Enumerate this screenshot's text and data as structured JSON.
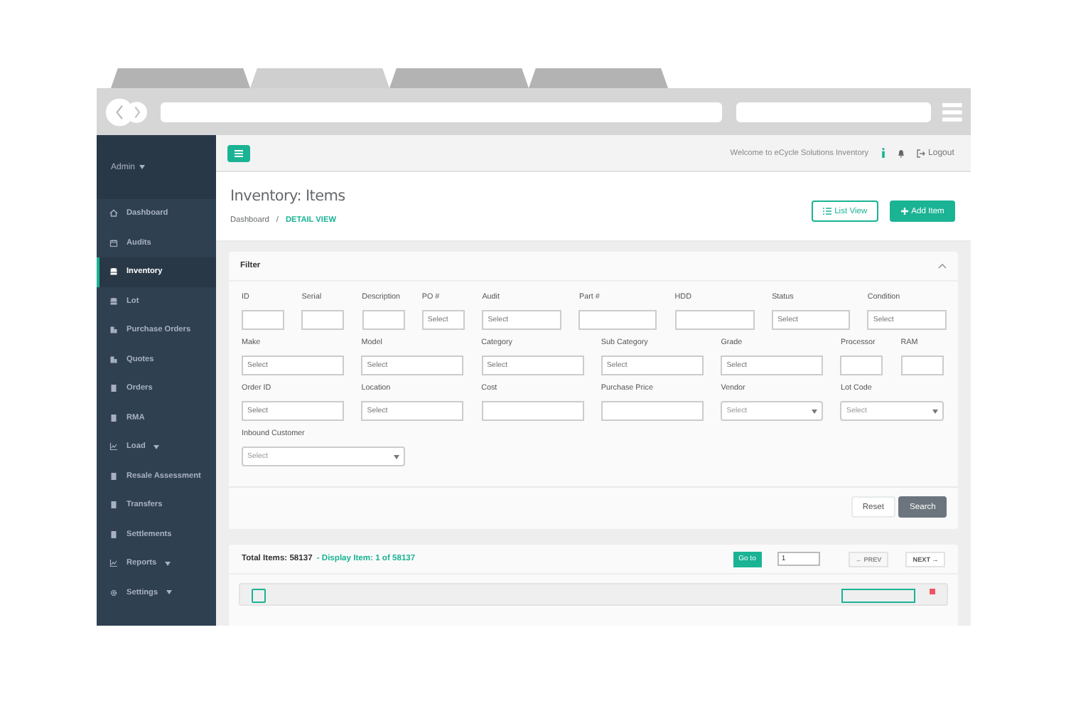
{
  "browser": {
    "tabs": [
      {
        "selected": false
      },
      {
        "selected": true
      },
      {
        "selected": false
      },
      {
        "selected": false
      }
    ]
  },
  "sidebar": {
    "user": "Admin",
    "items": [
      {
        "label": "Dashboard",
        "selected": false,
        "caret": false
      },
      {
        "label": "Audits",
        "selected": false,
        "caret": false
      },
      {
        "label": "Inventory",
        "selected": true,
        "caret": false
      },
      {
        "label": "Lot",
        "selected": false,
        "caret": false
      },
      {
        "label": "Purchase Orders",
        "selected": false,
        "caret": false
      },
      {
        "label": "Quotes",
        "selected": false,
        "caret": false
      },
      {
        "label": "Orders",
        "selected": false,
        "caret": false
      },
      {
        "label": "RMA",
        "selected": false,
        "caret": false
      },
      {
        "label": "Load",
        "selected": false,
        "caret": true
      },
      {
        "label": "Resale Assessment",
        "selected": false,
        "caret": false
      },
      {
        "label": "Transfers",
        "selected": false,
        "caret": false
      },
      {
        "label": "Settlements",
        "selected": false,
        "caret": false
      },
      {
        "label": "Reports",
        "selected": false,
        "caret": true
      },
      {
        "label": "Settings",
        "selected": false,
        "caret": true
      }
    ]
  },
  "topbar": {
    "welcome": "Welcome to eCycle Solutions Inventory",
    "logout": "Logout"
  },
  "heading": {
    "title": "Inventory: Items",
    "separator": "/",
    "breadcrumb": [
      {
        "label": "Dashboard",
        "current": false
      },
      {
        "label": "DETAIL VIEW",
        "current": true
      }
    ],
    "buttons": [
      {
        "label": "List View",
        "kind": "outline"
      },
      {
        "label": "Add Item",
        "kind": "primary"
      }
    ]
  },
  "filter": {
    "title": "Filter",
    "rows": [
      {
        "fields": [
          {
            "label": "ID",
            "kind": "text"
          },
          {
            "label": "Serial",
            "kind": "text"
          },
          {
            "label": "Description",
            "kind": "text"
          },
          {
            "label": "PO #",
            "kind": "text",
            "placeholder": "Select"
          },
          {
            "label": "Audit",
            "kind": "text",
            "placeholder": "Select"
          },
          {
            "label": "Part #",
            "kind": "text"
          },
          {
            "label": "HDD",
            "kind": "text"
          },
          {
            "label": "Status",
            "kind": "text",
            "placeholder": "Select"
          },
          {
            "label": "Condition",
            "kind": "text",
            "placeholder": "Select"
          }
        ]
      },
      {
        "fields": [
          {
            "label": "Make",
            "kind": "text",
            "placeholder": "Select"
          },
          {
            "label": "Model",
            "kind": "text",
            "placeholder": "Select"
          },
          {
            "label": "Category",
            "kind": "text",
            "placeholder": "Select"
          },
          {
            "label": "Sub Category",
            "kind": "text",
            "placeholder": "Select"
          },
          {
            "label": "Grade",
            "kind": "text",
            "placeholder": "Select"
          },
          {
            "label": "Processor",
            "kind": "text"
          },
          {
            "label": "RAM",
            "kind": "text"
          }
        ]
      },
      {
        "fields": [
          {
            "label": "Order ID",
            "kind": "text",
            "placeholder": "Select"
          },
          {
            "label": "Location",
            "kind": "text",
            "placeholder": "Select"
          },
          {
            "label": "Cost",
            "kind": "text"
          },
          {
            "label": "Purchase Price",
            "kind": "text"
          },
          {
            "label": "Vendor",
            "kind": "dropdown",
            "placeholder": "Select"
          },
          {
            "label": "Lot Code",
            "kind": "dropdown",
            "placeholder": "Select"
          }
        ]
      },
      {
        "fields": [
          {
            "label": "Inbound Customer",
            "kind": "dropdown",
            "placeholder": "Select"
          }
        ]
      }
    ],
    "actions": [
      {
        "label": "Reset",
        "kind": "default"
      },
      {
        "label": "Search",
        "kind": "dark"
      }
    ]
  },
  "results": {
    "total": "Total Items: 58137",
    "display": "- Display Item: 1 of 58137",
    "goto": "Go to",
    "page": "1",
    "pager": [
      {
        "label": "← PREV",
        "disabled": true
      },
      {
        "label": "NEXT →",
        "disabled": false
      }
    ],
    "items": [
      {
        "checked": false
      }
    ]
  }
}
